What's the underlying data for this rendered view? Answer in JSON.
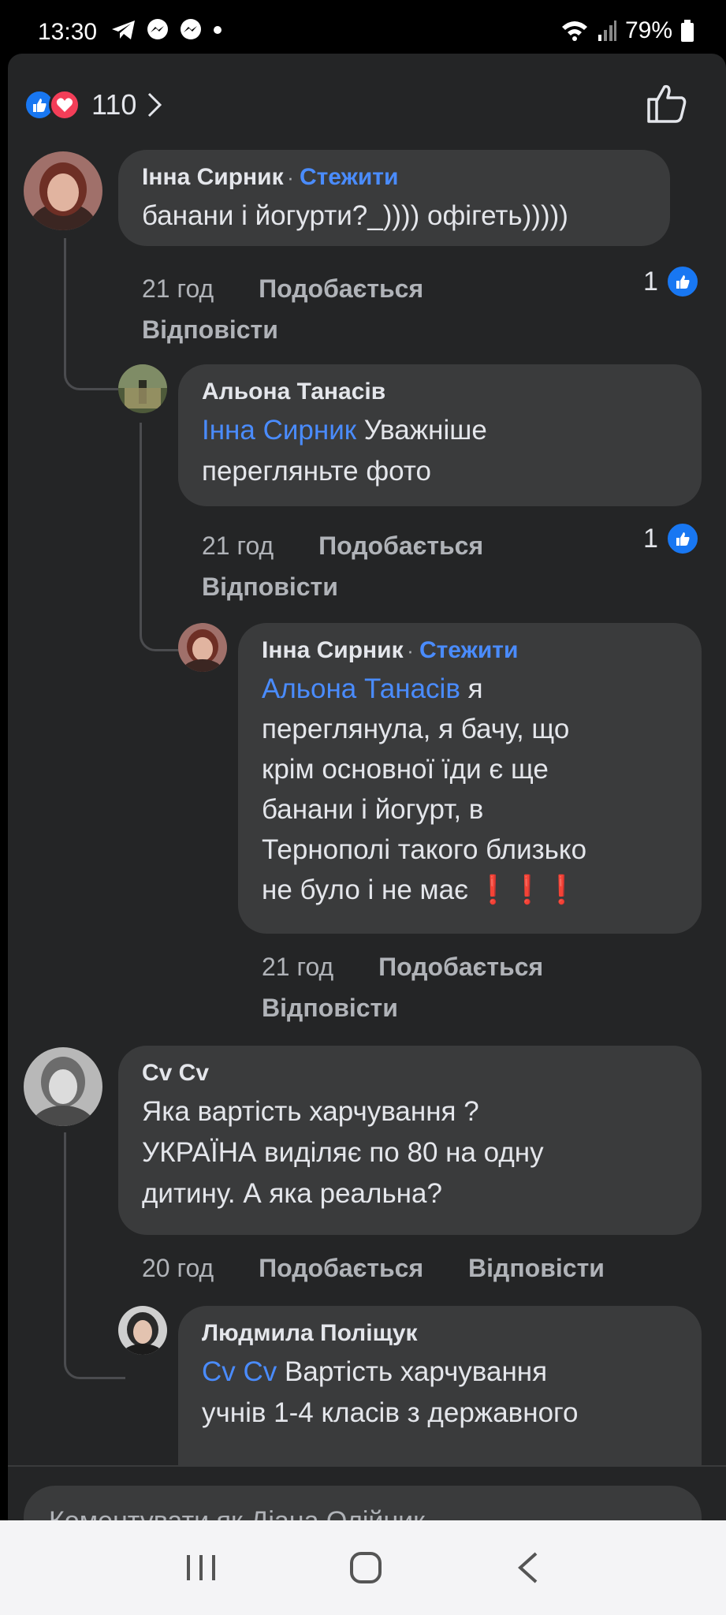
{
  "status_bar": {
    "time": "13:30",
    "battery": "79%"
  },
  "reactions": {
    "count": "110"
  },
  "comments": [
    {
      "author": "Інна Сирник",
      "follow": "Стежити",
      "lines": [
        "банани і йогурти?_)))) офігеть)))))"
      ],
      "time": "21 год",
      "like": "Подобається",
      "reply": "Відповісти",
      "likes": "1"
    },
    {
      "author": "Альона Танасів",
      "mention": "Інна Сирник",
      "text_after_mention": " Уважніше",
      "line2": "перегляньте фото",
      "time": "21 год",
      "like": "Подобається",
      "reply": "Відповісти",
      "likes": "1"
    },
    {
      "author": "Інна Сирник",
      "follow": "Стежити",
      "mention": "Альона Танасів",
      "text_after_mention": " я",
      "lines": [
        "переглянула, я бачу, що",
        "крім основної їди є ще",
        "банани і йогурт, в",
        "Тернополі такого близько",
        "не було і не має "
      ],
      "emoji": "❗❗❗",
      "time": "21 год",
      "like": "Подобається",
      "reply": "Відповісти"
    },
    {
      "author": "Cv Cv",
      "lines": [
        "Яка вартість харчування ?",
        "УКРАЇНА виділяє по 80 на одну",
        "дитину. А яка реальна?"
      ],
      "time": "20 год",
      "like": "Подобається",
      "reply": "Відповісти"
    },
    {
      "author": "Людмила Поліщук",
      "mention": "Cv Cv",
      "text_after_mention": " Вартість харчування",
      "line2": "учнів 1-4 класів з державного"
    }
  ],
  "composer": {
    "placeholder": "Коментувати як Діана Олійник"
  }
}
